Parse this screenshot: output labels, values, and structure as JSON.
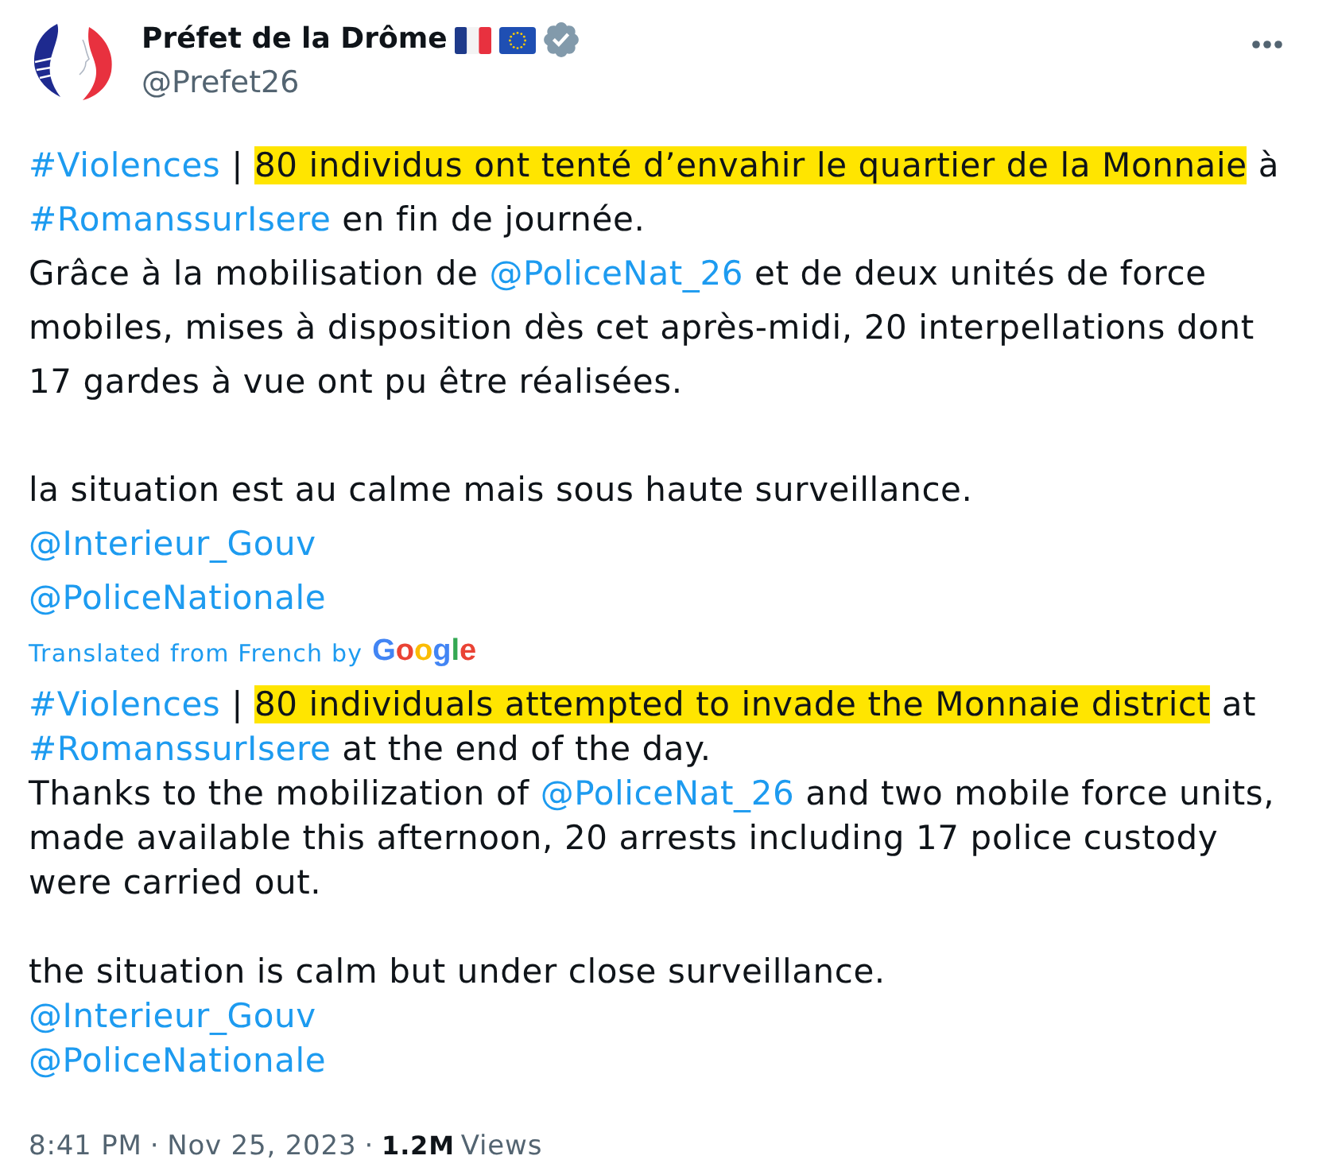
{
  "author": {
    "name": "Préfet de la Drôme",
    "handle": "@Prefet26",
    "verified": true
  },
  "tweet": {
    "paragraph_groups": [
      [
        {
          "segments": [
            {
              "kind": "hashtag",
              "text": "#Violences"
            },
            {
              "kind": "text",
              "text": " | "
            },
            {
              "kind": "highlight",
              "text": "80 individus ont tenté d’envahir le quartier de la Monnaie"
            },
            {
              "kind": "text",
              "text": " à "
            },
            {
              "kind": "hashtag",
              "text": "#RomanssurIsere"
            },
            {
              "kind": "text",
              "text": " en fin de journée."
            }
          ]
        },
        {
          "segments": [
            {
              "kind": "text",
              "text": "Grâce à la mobilisation de "
            },
            {
              "kind": "mention",
              "text": "@PoliceNat_26"
            },
            {
              "kind": "text",
              "text": " et de deux unités de force mobiles, mises à disposition dès cet après-midi, 20 interpellations dont 17 gardes à vue ont pu être réalisées."
            }
          ]
        }
      ],
      [
        {
          "segments": [
            {
              "kind": "text",
              "text": "la situation est au calme mais sous haute surveillance."
            }
          ]
        },
        {
          "segments": [
            {
              "kind": "mention",
              "text": "@Interieur_Gouv"
            }
          ]
        },
        {
          "segments": [
            {
              "kind": "mention",
              "text": "@PoliceNationale"
            }
          ]
        }
      ]
    ]
  },
  "translation": {
    "note": "Translated from French by",
    "provider": "Google",
    "paragraph_groups": [
      [
        {
          "segments": [
            {
              "kind": "hashtag",
              "text": "#Violences"
            },
            {
              "kind": "text",
              "text": " | "
            },
            {
              "kind": "highlight",
              "text": "80 individuals attempted to invade the Monnaie district"
            },
            {
              "kind": "text",
              "text": " at "
            },
            {
              "kind": "hashtag",
              "text": "#RomanssurIsere"
            },
            {
              "kind": "text",
              "text": " at the end of the day."
            }
          ]
        },
        {
          "segments": [
            {
              "kind": "text",
              "text": "Thanks to the mobilization of "
            },
            {
              "kind": "mention",
              "text": "@PoliceNat_26"
            },
            {
              "kind": "text",
              "text": " and two mobile force units, made available this afternoon, 20 arrests including 17 police custody were carried out."
            }
          ]
        }
      ],
      [
        {
          "segments": [
            {
              "kind": "text",
              "text": "the situation is calm but under close surveillance."
            }
          ]
        },
        {
          "segments": [
            {
              "kind": "mention",
              "text": "@Interieur_Gouv"
            }
          ]
        },
        {
          "segments": [
            {
              "kind": "mention",
              "text": "@PoliceNationale"
            }
          ]
        }
      ]
    ]
  },
  "footer": {
    "parts": [
      {
        "kind": "time",
        "text": "8:41 PM"
      },
      {
        "kind": "separator",
        "text": "·"
      },
      {
        "kind": "date",
        "text": "Nov 25, 2023"
      },
      {
        "kind": "separator",
        "text": "·"
      },
      {
        "kind": "count",
        "text": "1.2M"
      },
      {
        "kind": "label",
        "text": "Views"
      }
    ]
  }
}
